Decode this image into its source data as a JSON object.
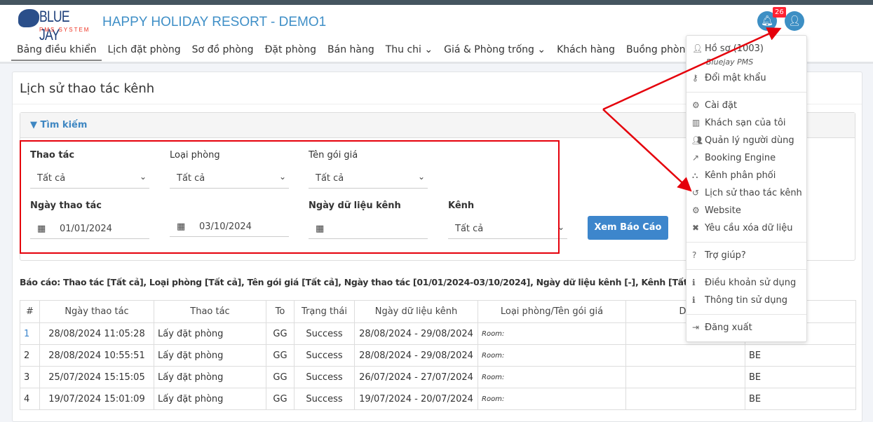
{
  "header": {
    "logo_text": "BLUE JAY",
    "logo_sub": "PMS SYSTEM",
    "hotel": "HAPPY HOLIDAY RESORT - DEMO1",
    "notification_count": "26"
  },
  "nav": [
    "Bảng điều khiển",
    "Lịch đặt phòng",
    "Sơ đồ phòng",
    "Đặt phòng",
    "Bán hàng",
    "Thu chi ⌄",
    "Giá & Phòng trống ⌄",
    "Khách hàng",
    "Buồng phòng ⌄"
  ],
  "page_title": "Lịch sử thao tác kênh",
  "search": {
    "header": "Tìm kiếm",
    "thao_tac_label": "Thao tác",
    "thao_tac": "Tất cả",
    "loai_phong_label": "Loại phòng",
    "loai_phong": "Tất cả",
    "goi_gia_label": "Tên gói giá",
    "goi_gia": "Tất cả",
    "ngay_label": "Ngày thao tác",
    "from": "01/01/2024",
    "to": "03/10/2024",
    "ngay_kenh_label": "Ngày dữ liệu kênh",
    "ngay_kenh": "",
    "kenh_label": "Kênh",
    "kenh": "Tất cả",
    "submit": "Xem Báo Cáo"
  },
  "report": "Báo cáo: Thao tác [Tất cả], Loại phòng [Tất cả], Tên gói giá [Tất cả], Ngày thao tác [01/01/2024-03/10/2024], Ngày dữ liệu kênh [-], Kênh [Tất cả]",
  "table": {
    "headers": [
      "#",
      "Ngày thao tác",
      "Thao tác",
      "To",
      "Trạng thái",
      "Ngày dữ liệu kênh",
      "Loại phòng/Tên gói giá",
      "Da",
      ""
    ],
    "rows": [
      [
        "1",
        "28/08/2024 11:05:28",
        "Lấy đặt phòng",
        "GG",
        "Success",
        "28/08/2024 - 29/08/2024",
        "Room:",
        "",
        ""
      ],
      [
        "2",
        "28/08/2024 10:55:51",
        "Lấy đặt phòng",
        "GG",
        "Success",
        "28/08/2024 - 29/08/2024",
        "Room:",
        "",
        "BE"
      ],
      [
        "3",
        "25/07/2024 15:15:05",
        "Lấy đặt phòng",
        "GG",
        "Success",
        "26/07/2024 - 27/07/2024",
        "Room:",
        "",
        "BE"
      ],
      [
        "4",
        "19/07/2024 15:01:09",
        "Lấy đặt phòng",
        "GG",
        "Success",
        "19/07/2024 - 20/07/2024",
        "Room:",
        "",
        "BE"
      ]
    ]
  },
  "menu": {
    "profile": "Hồ sơ (1003)",
    "profile_sub": "Bluejay PMS",
    "password": "Đổi mật khẩu",
    "settings": "Cài đặt",
    "hotels": "Khách sạn của tôi",
    "users": "Quản lý người dùng",
    "booking": "Booking Engine",
    "channels": "Kênh phân phối",
    "history": "Lịch sử thao tác kênh",
    "website": "Website",
    "delete": "Yêu cầu xóa dữ liệu",
    "help": "Trợ giúp?",
    "terms": "Điều khoản sử dụng",
    "info": "Thông tin sử dụng",
    "logout": "Đăng xuất"
  },
  "colors": {
    "accent": "#3d86cc",
    "annotation": "#e5000b"
  }
}
